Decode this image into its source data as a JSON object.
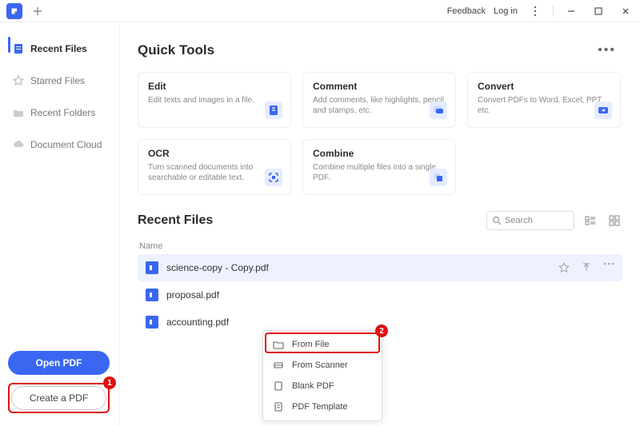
{
  "titlebar": {
    "feedback": "Feedback",
    "login": "Log in"
  },
  "sidebar": {
    "items": [
      {
        "label": "Recent Files"
      },
      {
        "label": "Starred Files"
      },
      {
        "label": "Recent Folders"
      },
      {
        "label": "Document Cloud"
      }
    ],
    "open_label": "Open PDF",
    "create_label": "Create a PDF",
    "badge1": "1"
  },
  "quicktools": {
    "title": "Quick Tools",
    "tools": [
      {
        "title": "Edit",
        "desc": "Edit texts and images in a file."
      },
      {
        "title": "Comment",
        "desc": "Add comments, like highlights, pencil and stamps, etc."
      },
      {
        "title": "Convert",
        "desc": "Convert PDFs to Word, Excel, PPT, etc."
      },
      {
        "title": "OCR",
        "desc": "Turn scanned documents into searchable or editable text."
      },
      {
        "title": "Combine",
        "desc": "Combine multiple files into a single PDF."
      }
    ]
  },
  "recent": {
    "title": "Recent Files",
    "search_placeholder": "Search",
    "col_name": "Name",
    "files": [
      {
        "name": "science-copy - Copy.pdf"
      },
      {
        "name": "proposal.pdf"
      },
      {
        "name": "accounting.pdf"
      }
    ]
  },
  "popup": {
    "items": [
      {
        "label": "From File"
      },
      {
        "label": "From Scanner"
      },
      {
        "label": "Blank PDF"
      },
      {
        "label": "PDF Template"
      }
    ],
    "badge2": "2"
  }
}
